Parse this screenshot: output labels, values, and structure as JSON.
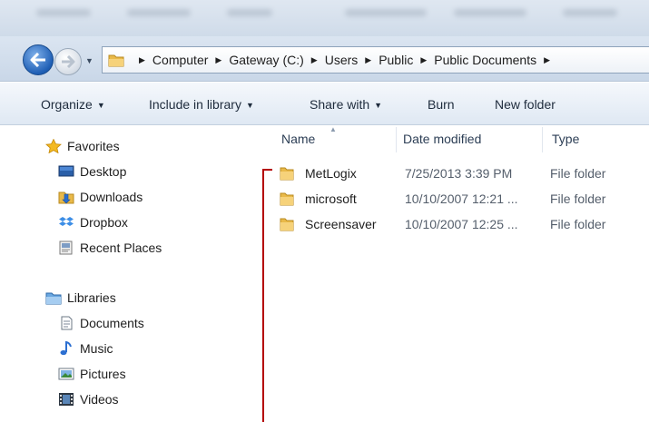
{
  "address": {
    "crumbs": [
      "Computer",
      "Gateway (C:)",
      "Users",
      "Public",
      "Public Documents"
    ]
  },
  "toolbar": {
    "organize": "Organize",
    "include": "Include in library",
    "share": "Share with",
    "burn": "Burn",
    "new_folder": "New folder"
  },
  "sidebar": {
    "favorites_header": "Favorites",
    "favorites": [
      "Desktop",
      "Downloads",
      "Dropbox",
      "Recent Places"
    ],
    "libraries_header": "Libraries",
    "libraries": [
      "Documents",
      "Music",
      "Pictures",
      "Videos"
    ]
  },
  "columns": {
    "name": "Name",
    "date": "Date modified",
    "type": "Type"
  },
  "files": [
    {
      "name": "MetLogix",
      "date": "7/25/2013 3:39 PM",
      "type": "File folder"
    },
    {
      "name": "microsoft",
      "date": "10/10/2007 12:21 ...",
      "type": "File folder"
    },
    {
      "name": "Screensaver",
      "date": "10/10/2007 12:25 ...",
      "type": "File folder"
    }
  ],
  "colors": {
    "accent": "#1f5fb5",
    "tree_line": "#b40000",
    "folder": "#e9b949"
  }
}
